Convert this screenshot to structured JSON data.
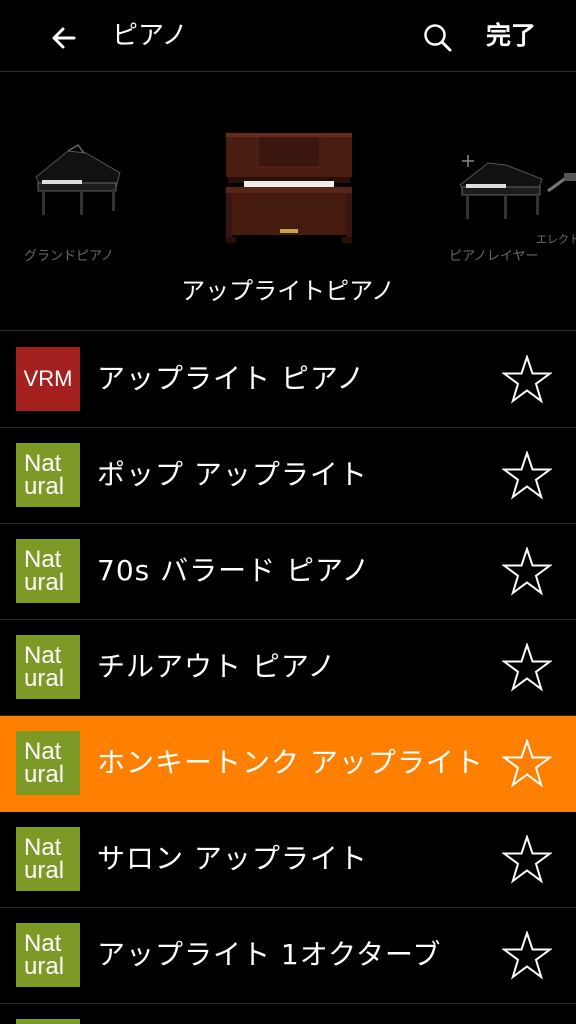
{
  "header": {
    "title": "ピアノ",
    "done_label": "完了",
    "back_icon": "back-arrow-icon",
    "search_icon": "search-icon"
  },
  "carousel": {
    "left_label": "グランドピアノ",
    "main_label": "アップライトピアノ",
    "right_label": "ピアノレイヤー",
    "far_right_label": "エレクトリ"
  },
  "voices": [
    {
      "badge": "VRM",
      "label": "アップライト ピアノ",
      "selected": false
    },
    {
      "badge": "Natural",
      "label": "ポップ アップライト",
      "selected": false
    },
    {
      "badge": "Natural",
      "label": "70s バラード ピアノ",
      "selected": false
    },
    {
      "badge": "Natural",
      "label": "チルアウト ピアノ",
      "selected": false
    },
    {
      "badge": "Natural",
      "label": "ホンキートンク アップライト",
      "selected": true
    },
    {
      "badge": "Natural",
      "label": "サロン アップライト",
      "selected": false
    },
    {
      "badge": "Natural",
      "label": "アップライト 1オクターブ",
      "selected": false
    }
  ],
  "badges": {
    "vrm": "VRM",
    "nat_top": "Nat",
    "nat_bottom": "ural"
  },
  "colors": {
    "accent": "#ff8000",
    "vrm": "#a3201f",
    "natural": "#7e9a26"
  }
}
